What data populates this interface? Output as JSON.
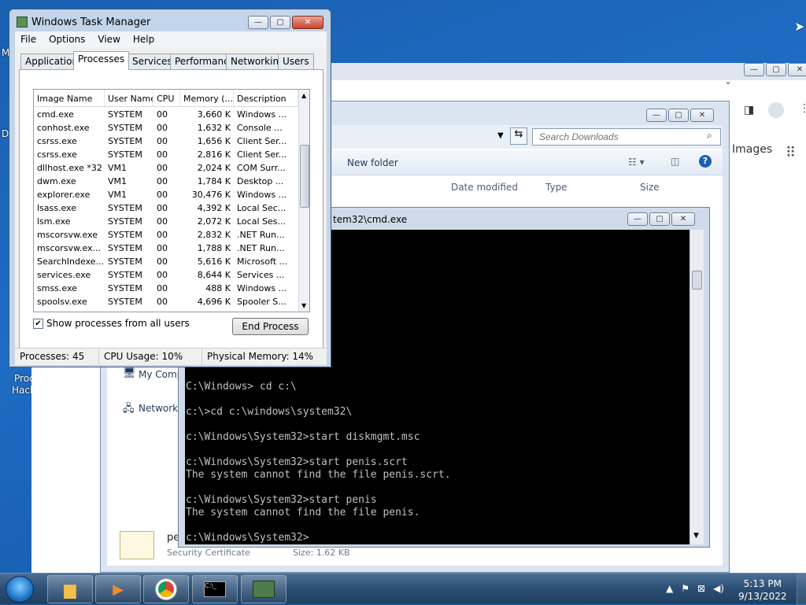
{
  "chrome": {
    "images_label": "Images"
  },
  "explorer": {
    "search_placeholder": "Search Downloads",
    "new_folder": "New folder",
    "columns": {
      "date_modified": "Date modified",
      "type": "Type",
      "size": "Size"
    },
    "sidebar": {
      "my_computer": "My Comp",
      "network": "Network"
    },
    "file_name_partial": "pe",
    "file_type_partial": "Security Certificate",
    "file_size_partial": "Size: 1.62 KB"
  },
  "cmd": {
    "title": "tem32\\cmd.exe",
    "lines": [
      "...",
      "",
      "...",
      "",
      "..",
      "",
      "",
      "",
      "",
      "",
      "",
      "",
      "C:\\Windows> cd c:\\",
      "",
      "c:\\>cd c:\\windows\\system32\\",
      "",
      "c:\\Windows\\System32>start diskmgmt.msc",
      "",
      "c:\\Windows\\System32>start penis.scrt",
      "The system cannot find the file penis.scrt.",
      "",
      "c:\\Windows\\System32>start penis",
      "The system cannot find the file penis.",
      "",
      "c:\\Windows\\System32>"
    ]
  },
  "taskmgr": {
    "title": "Windows Task Manager",
    "menu": [
      "File",
      "Options",
      "View",
      "Help"
    ],
    "tabs": [
      "Applications",
      "Processes",
      "Services",
      "Performance",
      "Networking",
      "Users"
    ],
    "active_tab": "Processes",
    "columns": [
      "Image Name",
      "User Name",
      "CPU",
      "Memory (...",
      "Description"
    ],
    "rows": [
      [
        "cmd.exe",
        "SYSTEM",
        "00",
        "3,660 K",
        "Windows ..."
      ],
      [
        "conhost.exe",
        "SYSTEM",
        "00",
        "1,632 K",
        "Console ..."
      ],
      [
        "csrss.exe",
        "SYSTEM",
        "00",
        "1,656 K",
        "Client Ser..."
      ],
      [
        "csrss.exe",
        "SYSTEM",
        "00",
        "2,816 K",
        "Client Ser..."
      ],
      [
        "dllhost.exe *32",
        "VM1",
        "00",
        "2,024 K",
        "COM Surr..."
      ],
      [
        "dwm.exe",
        "VM1",
        "00",
        "1,784 K",
        "Desktop ..."
      ],
      [
        "explorer.exe",
        "VM1",
        "00",
        "30,476 K",
        "Windows ..."
      ],
      [
        "lsass.exe",
        "SYSTEM",
        "00",
        "4,392 K",
        "Local Sec..."
      ],
      [
        "lsm.exe",
        "SYSTEM",
        "00",
        "2,072 K",
        "Local Ses..."
      ],
      [
        "mscorsvw.exe",
        "SYSTEM",
        "00",
        "2,832 K",
        ".NET Run..."
      ],
      [
        "mscorsvw.ex...",
        "SYSTEM",
        "00",
        "1,788 K",
        ".NET Run..."
      ],
      [
        "SearchIndexe...",
        "SYSTEM",
        "00",
        "5,616 K",
        "Microsoft ..."
      ],
      [
        "services.exe",
        "SYSTEM",
        "00",
        "8,644 K",
        "Services ..."
      ],
      [
        "smss.exe",
        "SYSTEM",
        "00",
        "488 K",
        "Windows ..."
      ],
      [
        "spoolsv.exe",
        "SYSTEM",
        "00",
        "4,696 K",
        "Spooler S..."
      ]
    ],
    "show_all_label": "Show processes from all users",
    "end_process": "End Process",
    "status": {
      "processes": "Processes: 45",
      "cpu": "CPU Usage: 10%",
      "memory": "Physical Memory: 14%"
    }
  },
  "desktop": {
    "icon_label_1": "Proc",
    "icon_label_2": "Hack",
    "left_letter_m": "M",
    "left_letter_d": "D"
  },
  "taskbar": {
    "time": "5:13 PM",
    "date": "9/13/2022"
  }
}
